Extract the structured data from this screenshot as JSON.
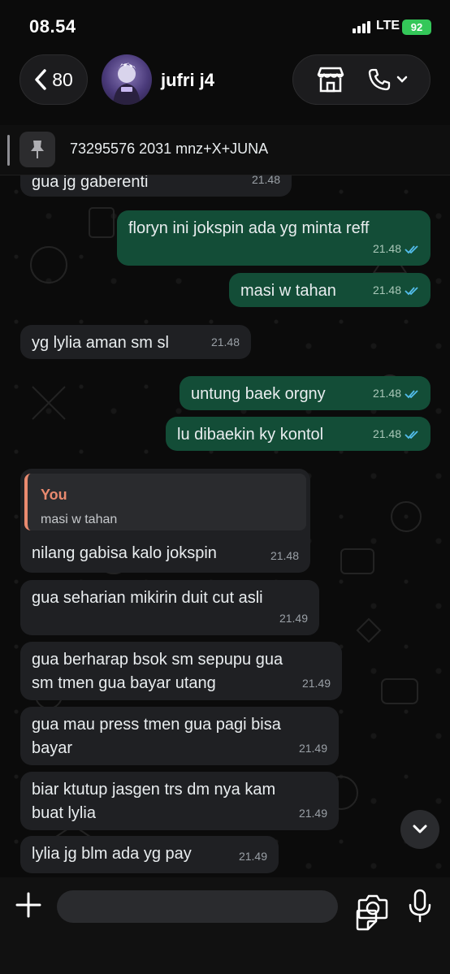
{
  "status_bar": {
    "time": "08.54",
    "network": "LTE",
    "battery": "92"
  },
  "header": {
    "back_count": "80",
    "contact_name": "jufri j4"
  },
  "pinned": {
    "text": "73295576 2031 mnz+X+JUNA"
  },
  "messages": [
    {
      "text": "gua jg gaberenti",
      "time": "21.48",
      "direction": "in"
    },
    {
      "text": "floryn ini jokspin ada yg minta reff",
      "time": "21.48",
      "direction": "out"
    },
    {
      "text": "masi w tahan",
      "time": "21.48",
      "direction": "out"
    },
    {
      "text": "yg lylia aman sm sl",
      "time": "21.48",
      "direction": "in"
    },
    {
      "text": "untung baek orgny",
      "time": "21.48",
      "direction": "out"
    },
    {
      "text": "lu dibaekin ky kontol",
      "time": "21.48",
      "direction": "out"
    },
    {
      "quote_name": "You",
      "quote_text": "masi w tahan",
      "text": "nilang gabisa kalo jokspin",
      "time": "21.48",
      "direction": "in"
    },
    {
      "text": "gua seharian mikirin duit cut asli",
      "time": "21.49",
      "direction": "in"
    },
    {
      "text_line1": "gua berharap bsok sm sepupu gua",
      "text_line2": "sm tmen gua bayar utang",
      "time": "21.49",
      "direction": "in"
    },
    {
      "text_line1": "gua mau press tmen gua pagi bisa",
      "text_line2": "bayar",
      "time": "21.49",
      "direction": "in"
    },
    {
      "text_line1": "biar ktutup jasgen trs dm nya kam",
      "text_line2": "buat lylia",
      "time": "21.49",
      "direction": "in"
    },
    {
      "text": "lylia jg blm ada yg pay",
      "time": "21.49",
      "direction": "in"
    }
  ],
  "colors": {
    "incoming": "#1f2023",
    "outgoing": "#134d37",
    "quote_accent": "#e98a6f",
    "read_tick": "#53bdeb"
  }
}
